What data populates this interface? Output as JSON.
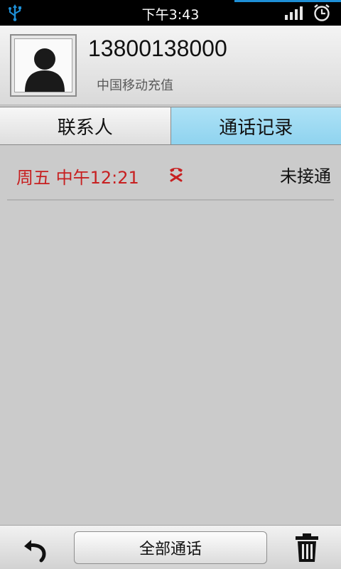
{
  "status_bar": {
    "time": "下午3:43",
    "icons": [
      "usb-icon",
      "signal-icon",
      "alarm-clock-icon"
    ]
  },
  "contact": {
    "phone_number": "13800138000",
    "operator": "中国移动充值"
  },
  "tabs": [
    {
      "label": "联系人",
      "active": false
    },
    {
      "label": "通话记录",
      "active": true
    }
  ],
  "call_log": [
    {
      "time": "周五 中午12:21",
      "icon": "missed-call-icon",
      "status": "未接通"
    }
  ],
  "bottom_bar": {
    "filter_label": "全部通话",
    "icons": [
      "back-arrow-icon",
      "trash-icon"
    ]
  },
  "colors": {
    "missed": "#c72021",
    "active_tab": "#9fdaf3",
    "status_accent": "#1e8fd6"
  }
}
